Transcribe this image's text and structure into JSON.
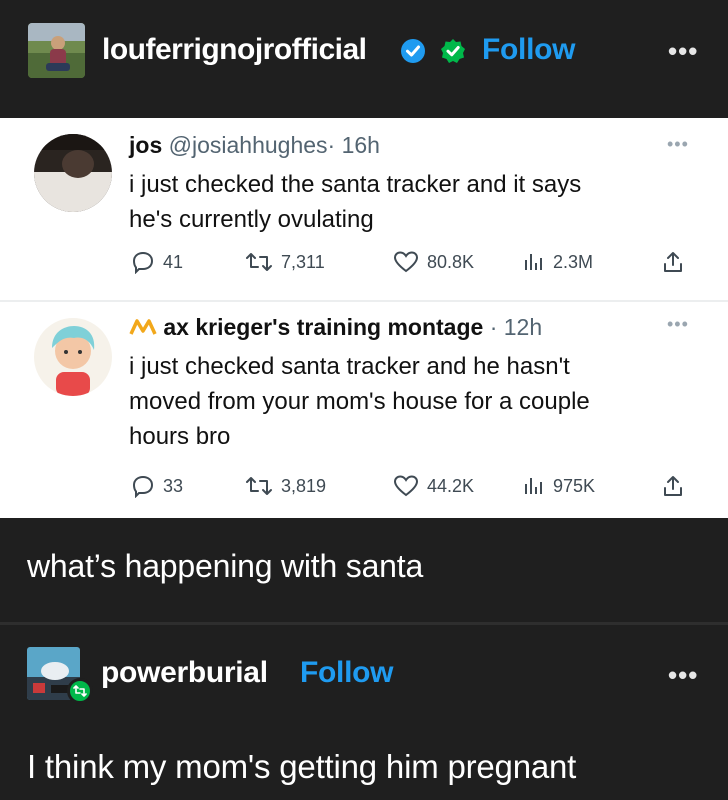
{
  "post": {
    "blog_name": "louferrignojrofficial",
    "follow_label": "Follow",
    "menu_label": "•••",
    "body_text": "what’s happening with santa"
  },
  "tweets": [
    {
      "display_name": "jos",
      "handle": "@josiahhughes",
      "time": "· 16h",
      "text_lines": [
        "i just checked the santa tracker and it says",
        "he's currently ovulating"
      ],
      "replies": "41",
      "retweets": "7,311",
      "likes": "80.8K",
      "views": "2.3M"
    },
    {
      "display_name": "ax krieger's training montage",
      "handle": "",
      "time": "· 12h",
      "text_lines": [
        "i just checked santa tracker and he hasn't",
        "moved from your mom's house for a couple",
        "hours bro"
      ],
      "replies": "33",
      "retweets": "3,819",
      "likes": "44.2K",
      "views": "975K"
    }
  ],
  "reblog": {
    "blog_name": "powerburial",
    "follow_label": "Follow",
    "menu_label": "•••",
    "text": "I think my mom's getting him pregnant"
  },
  "colors": {
    "background": "#1f1f1f",
    "accent_blue": "#1f9bf0",
    "verified_green": "#00b84a"
  }
}
